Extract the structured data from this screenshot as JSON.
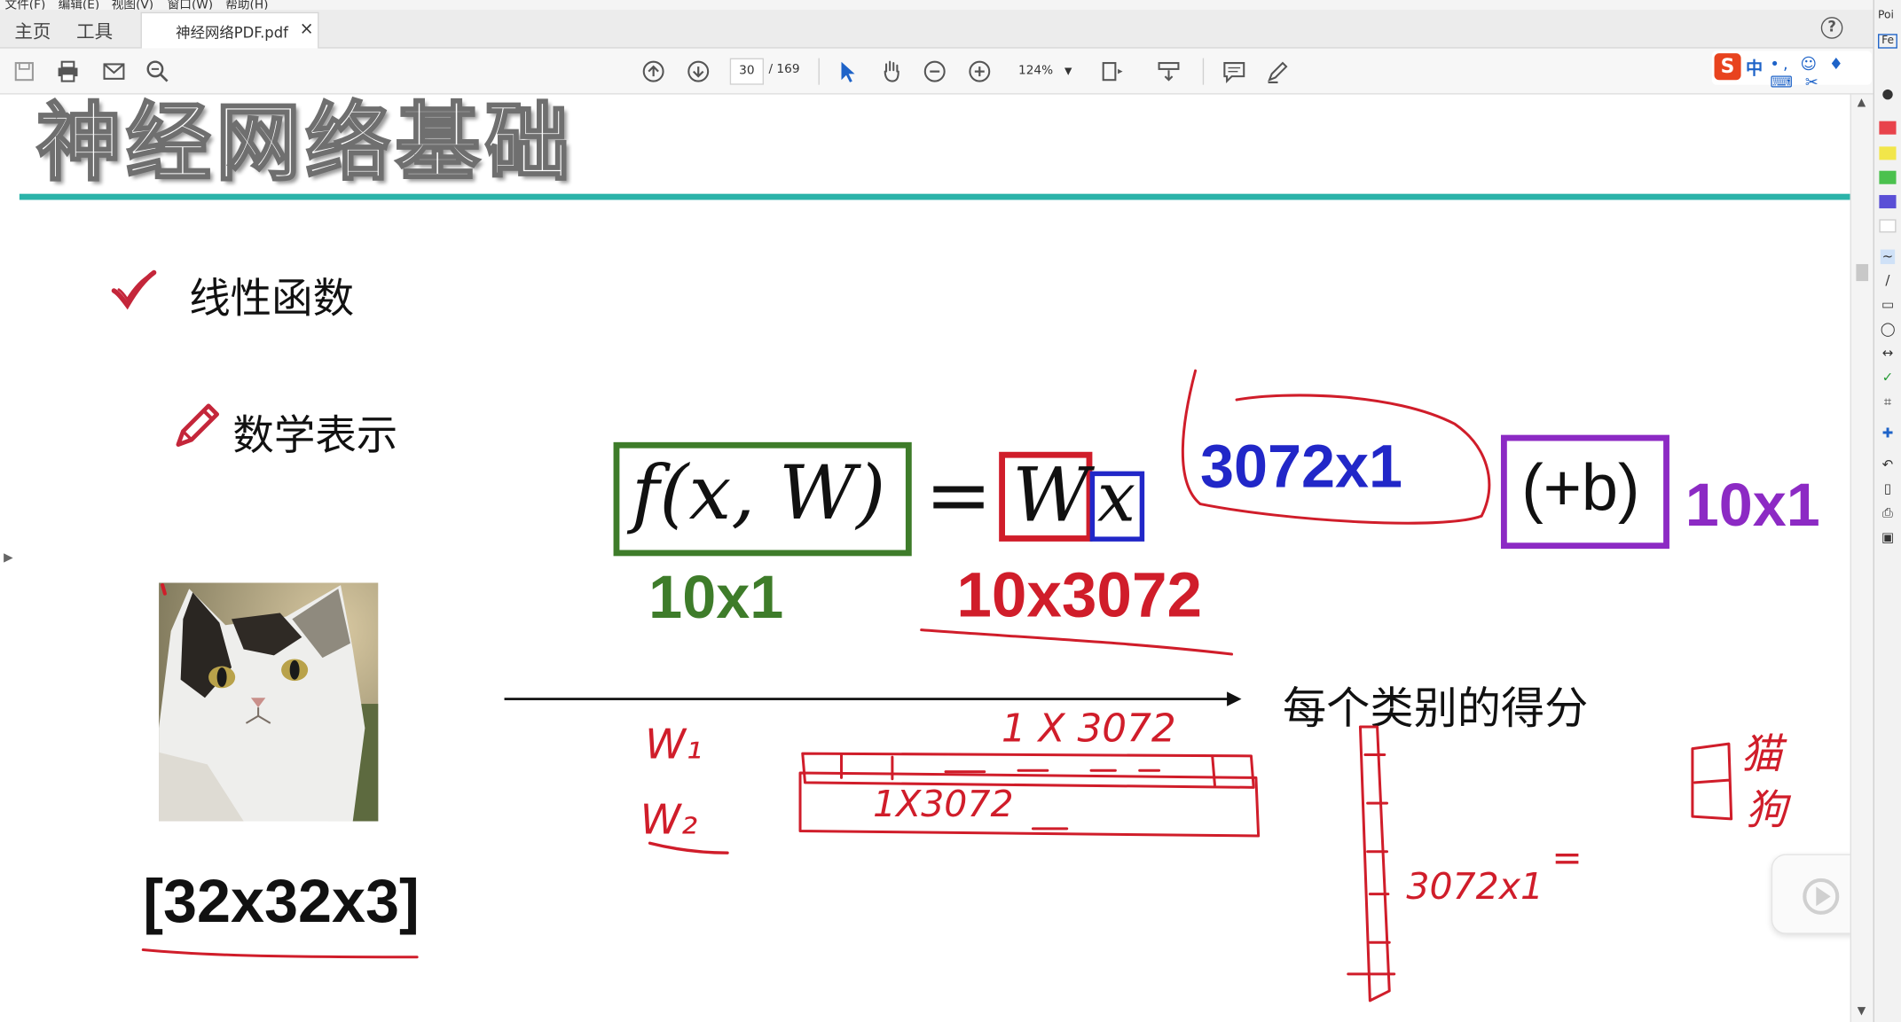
{
  "menubar": {
    "items": [
      "文件(F)",
      "编辑(E)",
      "视图(V)",
      "窗口(W)",
      "帮助(H)"
    ]
  },
  "tabs": {
    "home": "主页",
    "tools": "工具",
    "document": "神经网络PDF.pdf",
    "close_glyph": "×",
    "help_glyph": "?"
  },
  "toolbar": {
    "current_page": "30",
    "page_total": "/ 169",
    "zoom": "124%",
    "icons": [
      "save-icon",
      "print-icon",
      "email-icon",
      "search-zoom-icon",
      "page-up-icon",
      "page-down-icon",
      "select-arrow-icon",
      "hand-icon",
      "zoom-out-icon",
      "zoom-in-icon",
      "fit-page-icon",
      "scroll-mode-icon",
      "comment-icon",
      "highlight-pen-icon"
    ]
  },
  "ime": {
    "logo": "S",
    "lang": "中",
    "extras": "•, ☺ ♦ ⌨ ✂"
  },
  "right_strip": {
    "label_top": "Poi",
    "label_box": "Fe",
    "colors": [
      "#e8434b",
      "#f2e64a",
      "#4bc14e",
      "#5a4fd6",
      "#ffffff"
    ]
  },
  "slide": {
    "title": "神经网络基础",
    "bullet_1": "线性函数",
    "bullet_2": "数学表示",
    "formula_lhs": "f(x, W)",
    "equals": "=",
    "weight_symbol": "W",
    "input_symbol": "x",
    "bias_term": "(+b)",
    "dim_output": "10x1",
    "dim_weights": "10x3072",
    "dim_input": "3072x1",
    "dim_bias": "10x1",
    "image_dims": "[32x32x3]",
    "score_label": "每个类别的得分",
    "accent_color": "#2bb3a9"
  },
  "handwriting": {
    "row_label_1": "W₁",
    "row_label_2": "W₂",
    "row_dims_1": "1 X 3072",
    "row_dims_2": "1X3072",
    "col_dims": "3072x1",
    "equals": "=",
    "class_cat": "猫",
    "class_dog": "狗",
    "ink_color": "#d01d2a"
  }
}
